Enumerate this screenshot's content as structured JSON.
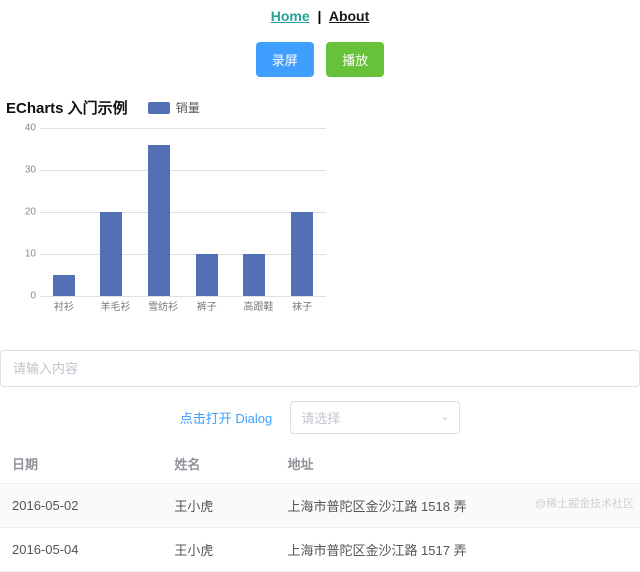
{
  "nav": {
    "home": "Home",
    "about": "About"
  },
  "buttons": {
    "record": "录屏",
    "play": "播放"
  },
  "chart_title": "ECharts 入门示例",
  "legend_label": "销量",
  "chart_data": {
    "type": "bar",
    "categories": [
      "衬衫",
      "羊毛衫",
      "雪纺衫",
      "裤子",
      "高跟鞋",
      "袜子"
    ],
    "values": [
      5,
      20,
      36,
      10,
      10,
      20
    ],
    "series": [
      {
        "name": "销量",
        "values": [
          5,
          20,
          36,
          10,
          10,
          20
        ]
      }
    ],
    "title": "ECharts 入门示例",
    "xlabel": "",
    "ylabel": "",
    "ylim": [
      0,
      40
    ],
    "yticks": [
      0,
      10,
      20,
      30,
      40
    ]
  },
  "input": {
    "placeholder": "请输入内容"
  },
  "dialog_link": "点击打开 Dialog",
  "select": {
    "placeholder": "请选择"
  },
  "table": {
    "headers": [
      "日期",
      "姓名",
      "地址"
    ],
    "rows": [
      {
        "date": "2016-05-02",
        "name": "王小虎",
        "addr": "上海市普陀区金沙江路 1518 弄"
      },
      {
        "date": "2016-05-04",
        "name": "王小虎",
        "addr": "上海市普陀区金沙江路 1517 弄"
      }
    ]
  },
  "watermark": "@稀土掘金技术社区"
}
